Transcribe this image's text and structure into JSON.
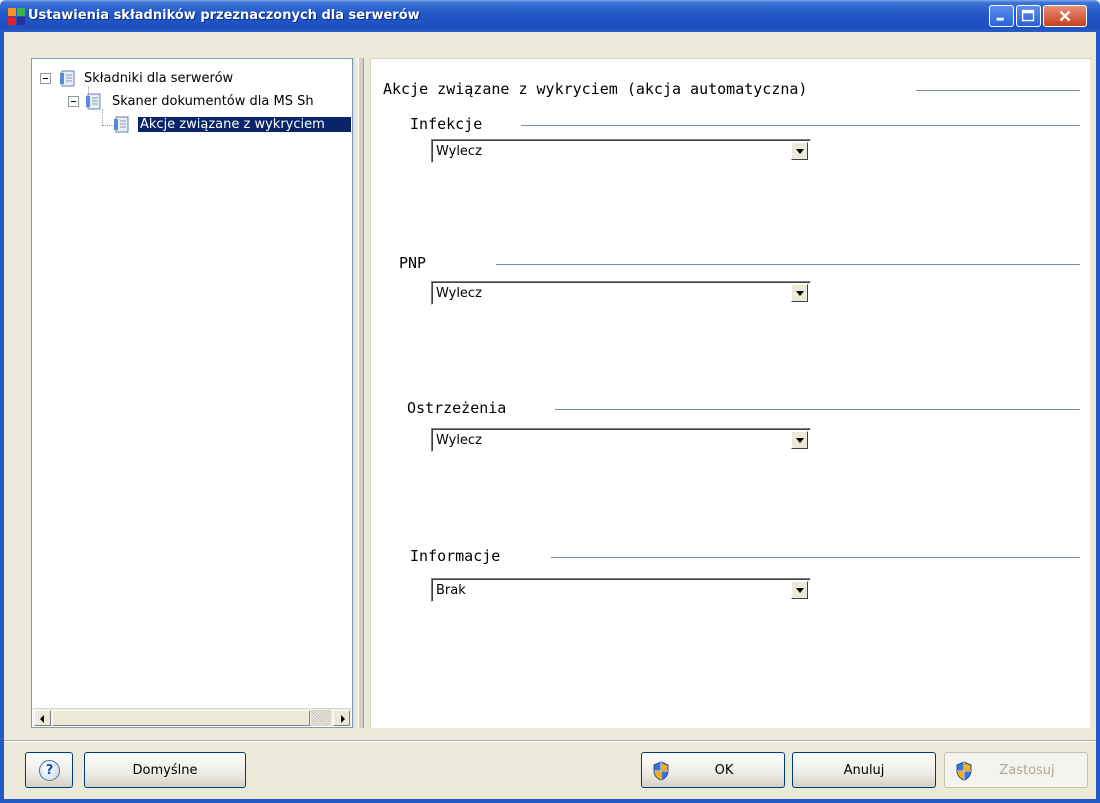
{
  "window": {
    "title": "Ustawienia składników przeznaczonych dla serwerów"
  },
  "tree": {
    "items": [
      {
        "label": "Składniki dla serwerów",
        "expanded": true
      },
      {
        "label": "Skaner dokumentów dla MS Sh",
        "expanded": true
      },
      {
        "label": "Akcje związane z wykryciem",
        "selected": true
      }
    ]
  },
  "main": {
    "section_title": "Akcje związane z wykryciem (akcja automatyczna)",
    "groups": [
      {
        "label": "Infekcje",
        "value": "Wylecz"
      },
      {
        "label": "PNP",
        "value": "Wylecz"
      },
      {
        "label": "Ostrzeżenia",
        "value": "Wylecz"
      },
      {
        "label": "Informacje",
        "value": "Brak"
      }
    ]
  },
  "footer": {
    "help_label": "?",
    "default_label": "Domyślne",
    "ok_label": "OK",
    "cancel_label": "Anuluj",
    "apply_label": "Zastosuj"
  },
  "colors": {
    "titlebar": "#2459c8",
    "selection": "#0a246a",
    "dialog_bg": "#ece9d8"
  }
}
